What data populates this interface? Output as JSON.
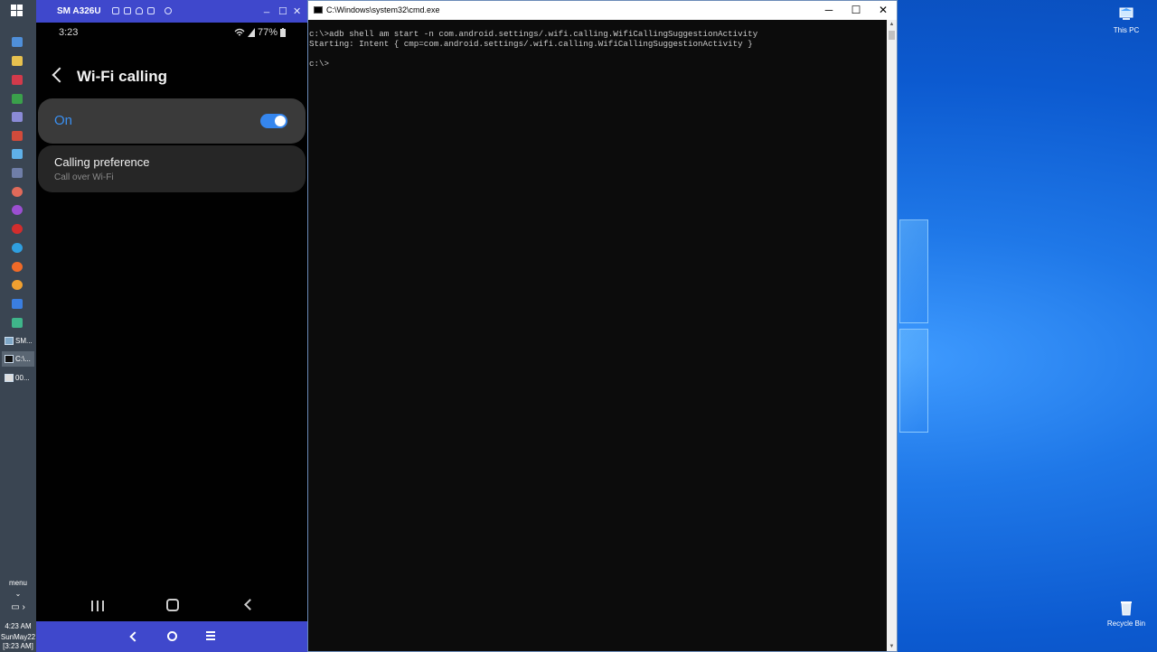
{
  "desktop": {
    "icons": [
      {
        "label": "This PC",
        "icon": "this-pc-icon"
      },
      {
        "label": "Recycle Bin",
        "icon": "recycle-bin-icon"
      }
    ]
  },
  "taskbar": {
    "tasks": [
      {
        "label": "SM..."
      },
      {
        "label": "C:\\..."
      },
      {
        "label": "00..."
      }
    ],
    "menu_label": "menu",
    "time": "4:23 AM",
    "date_line": "SunMay22",
    "date_time_line": "[3:23 AM]"
  },
  "phone_window": {
    "title": "SM A326U",
    "controls": [
      "_",
      "☐",
      "✕"
    ]
  },
  "phone": {
    "status_time": "3:23",
    "battery": "77%",
    "screen_title": "Wi-Fi calling",
    "toggle_label": "On",
    "toggle_on": true,
    "pref_title": "Calling preference",
    "pref_subtitle": "Call over Wi-Fi"
  },
  "cmd": {
    "title": "C:\\Windows\\system32\\cmd.exe",
    "controls": {
      "minimize": "─",
      "maximize": "☐",
      "close": "✕"
    },
    "lines": [
      "c:\\>adb shell am start -n com.android.settings/.wifi.calling.WifiCallingSuggestionActivity",
      "Starting: Intent { cmp=com.android.settings/.wifi.calling.WifiCallingSuggestionActivity }",
      "",
      "c:\\>"
    ]
  }
}
